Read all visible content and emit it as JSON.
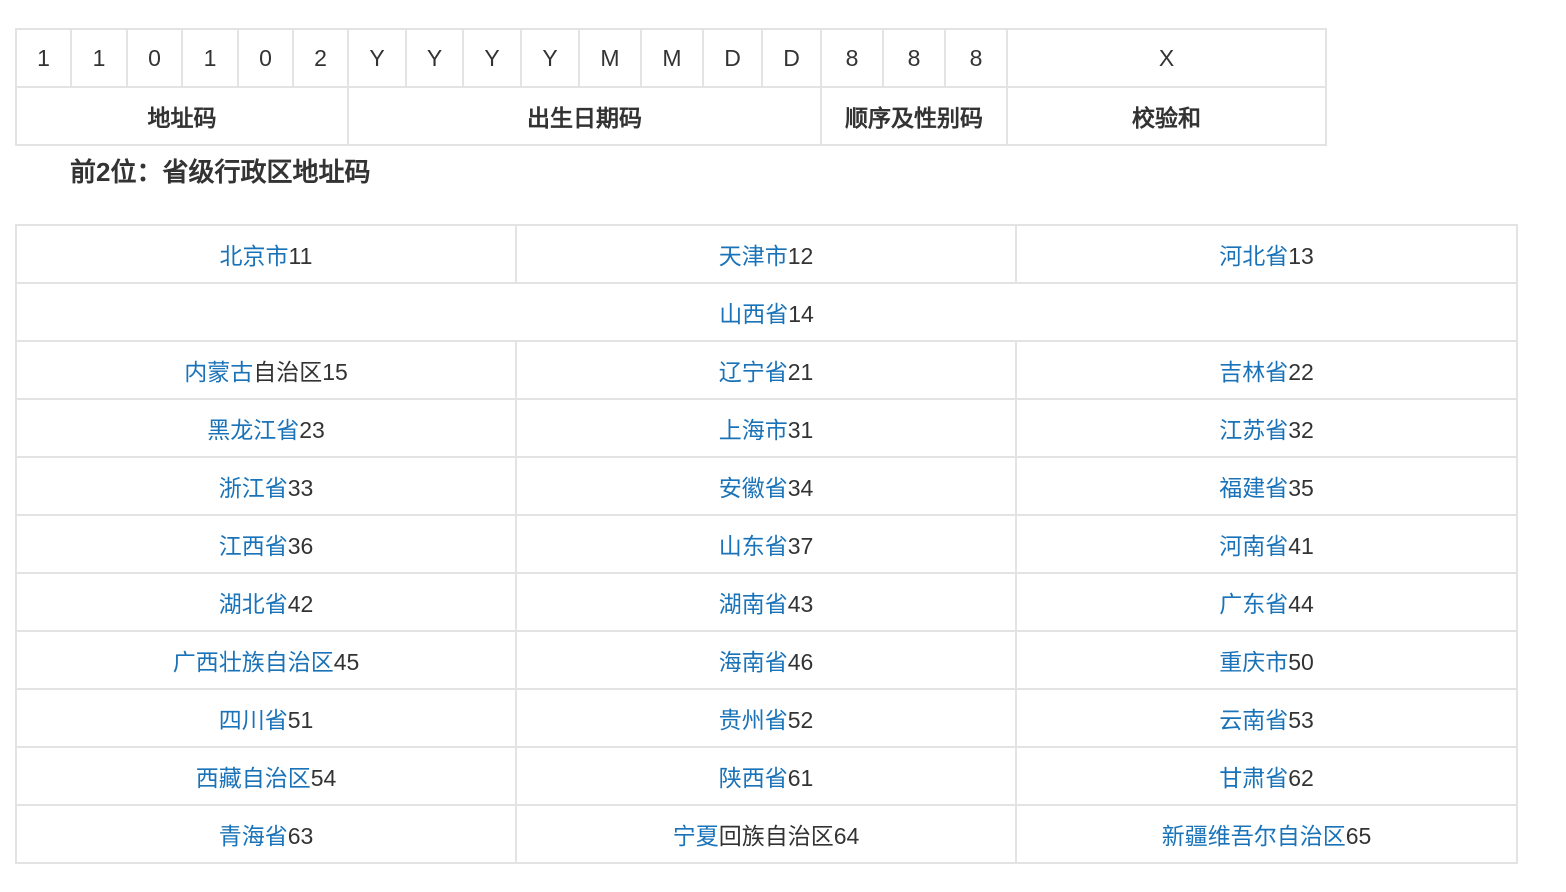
{
  "id_structure": {
    "digits": [
      "1",
      "1",
      "0",
      "1",
      "0",
      "2",
      "Y",
      "Y",
      "Y",
      "Y",
      "M",
      "M",
      "D",
      "D",
      "8",
      "8",
      "8",
      "X"
    ],
    "parts": [
      {
        "label": "地址码",
        "span": 6
      },
      {
        "label": "出生日期码",
        "span": 8
      },
      {
        "label": "顺序及性别码",
        "span": 3
      },
      {
        "label": "校验和",
        "span": 1
      }
    ]
  },
  "section_heading": "前2位：省级行政区地址码",
  "provinces": {
    "link_color": "#1a73b8",
    "rows": [
      [
        {
          "link": "北京市",
          "rest": "",
          "code": "11"
        },
        {
          "link": "天津市",
          "rest": "",
          "code": "12"
        },
        {
          "link": "河北省",
          "rest": "",
          "code": "13"
        }
      ],
      [
        {
          "link": "山西省",
          "rest": "",
          "code": "14",
          "colspan": 3
        }
      ],
      [
        {
          "link": "内蒙古",
          "rest": "自治区",
          "code": "15"
        },
        {
          "link": "辽宁省",
          "rest": "",
          "code": "21"
        },
        {
          "link": "吉林省",
          "rest": "",
          "code": "22"
        }
      ],
      [
        {
          "link": "黑龙江省",
          "rest": "",
          "code": "23"
        },
        {
          "link": "上海市",
          "rest": "",
          "code": "31"
        },
        {
          "link": "江苏省",
          "rest": "",
          "code": "32"
        }
      ],
      [
        {
          "link": "浙江省",
          "rest": "",
          "code": "33"
        },
        {
          "link": "安徽省",
          "rest": "",
          "code": "34"
        },
        {
          "link": "福建省",
          "rest": "",
          "code": "35"
        }
      ],
      [
        {
          "link": "江西省",
          "rest": "",
          "code": "36"
        },
        {
          "link": "山东省",
          "rest": "",
          "code": "37"
        },
        {
          "link": "河南省",
          "rest": "",
          "code": "41"
        }
      ],
      [
        {
          "link": "湖北省",
          "rest": "",
          "code": "42"
        },
        {
          "link": "湖南省",
          "rest": "",
          "code": "43"
        },
        {
          "link": "广东省",
          "rest": "",
          "code": "44"
        }
      ],
      [
        {
          "link": "广西壮族自治区",
          "rest": "",
          "code": "45"
        },
        {
          "link": "海南省",
          "rest": "",
          "code": "46"
        },
        {
          "link": "重庆市",
          "rest": "",
          "code": "50"
        }
      ],
      [
        {
          "link": "四川省",
          "rest": "",
          "code": "51"
        },
        {
          "link": "贵州省",
          "rest": "",
          "code": "52"
        },
        {
          "link": "云南省",
          "rest": "",
          "code": "53"
        }
      ],
      [
        {
          "link": "西藏自治区",
          "rest": "",
          "code": "54"
        },
        {
          "link": "陕西省",
          "rest": "",
          "code": "61"
        },
        {
          "link": "甘肃省",
          "rest": "",
          "code": "62"
        }
      ],
      [
        {
          "link": "青海省",
          "rest": "",
          "code": "63"
        },
        {
          "link": "宁夏",
          "rest": "回族自治区",
          "code": "64"
        },
        {
          "link": "新疆维吾尔自治区",
          "rest": "",
          "code": "65"
        }
      ]
    ]
  }
}
